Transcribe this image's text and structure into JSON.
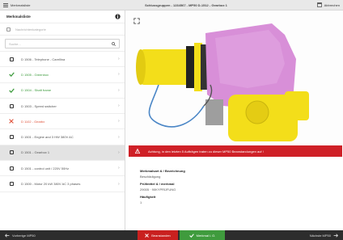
{
  "topbar": {
    "left_label": "Merkmalsliste",
    "title": "Schlussgruppen - 1234567 - MP50 D-1512 - Gearbox 1",
    "right_label": "Abbrechen"
  },
  "sidebar": {
    "title": "Merkmalsliste",
    "filter_label": "Nachrichtenkategorie",
    "search_placeholder": "Suche...",
    "items": [
      {
        "label": "D 1506 - Telephone - Carellina",
        "status": "checkbox"
      },
      {
        "label": "D 1505 - Greenbox",
        "status": "done"
      },
      {
        "label": "D 1504 - Shaft frame",
        "status": "done"
      },
      {
        "label": "D 1503 - Speed switcher",
        "status": "checkbox"
      },
      {
        "label": "D 1102 - Gearbx",
        "status": "error"
      },
      {
        "label": "D 1501 - Engine and 3 HW 380V AC",
        "status": "checkbox"
      },
      {
        "label": "D 1501 - Gearbox 1",
        "status": "checkbox",
        "selected": true
      },
      {
        "label": "D 1501 - control unit / 220V 50Hz",
        "status": "checkbox"
      },
      {
        "label": "D 1500 - Motor 20 kW 380V AC 3 phases",
        "status": "checkbox"
      }
    ]
  },
  "main": {
    "warning_text": "Achtung, in den letzten 5 Aufträgen traten zu dieser MP50 Beanstandungen auf !",
    "info": {
      "k1": "Merkmalsart & / Bezeichnung",
      "v1": "Beschädigung",
      "k2": "Prüfmittel & / merkmal",
      "v2": "29005 · 90KYPRÜFUNG",
      "k3": "Häufigkeit",
      "v3": "1"
    }
  },
  "bottombar": {
    "back_label": "Vorherige MP50",
    "reject_label": "Beanstanden",
    "ok_label": "Merkmal i. O.",
    "next_label": "Nächste MP50"
  },
  "colors": {
    "warning_red": "#cf2027",
    "ok_green": "#3f9b3d",
    "robot_yellow": "#f3de1a",
    "robot_pink": "#d88fd8"
  },
  "icons": {
    "expand": "expand-icon",
    "info": "info-icon",
    "warning": "warning-icon",
    "back": "arrow-left-icon",
    "next": "arrow-right-icon",
    "check": "checkmark-icon",
    "cross": "close-icon"
  }
}
